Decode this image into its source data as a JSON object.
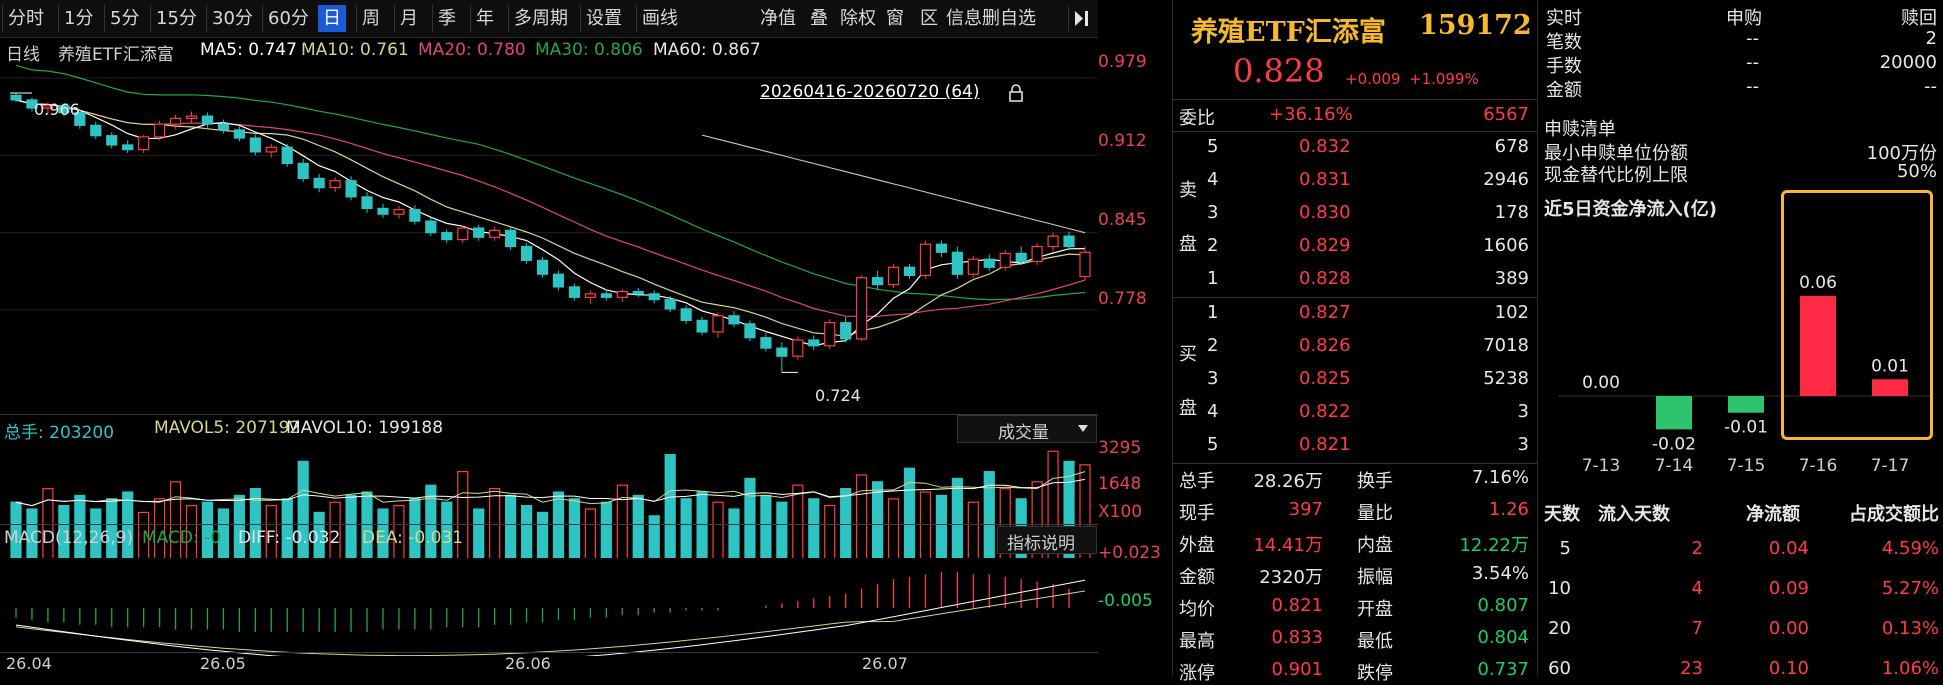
{
  "toolbar": {
    "periods": [
      "分时",
      "1分",
      "5分",
      "15分",
      "30分",
      "60分",
      "日",
      "周",
      "月",
      "季",
      "年",
      "多周期",
      "设置",
      "画线"
    ],
    "active": "日",
    "right_items": [
      "净值",
      "叠",
      "除权",
      "窗",
      "区",
      "信息",
      "删自选"
    ]
  },
  "chart_header": {
    "period": "日线",
    "name": "养殖ETF汇添富",
    "ma5": "MA5: 0.747",
    "ma10": "MA10: 0.761",
    "ma20": "MA20: 0.780",
    "ma30": "MA30: 0.806",
    "ma60": "MA60: 0.867",
    "range_label": "20260416-20260720 (64)",
    "high_mark": "0.966",
    "low_mark": "0.724"
  },
  "price_axis": [
    "0.979",
    "0.912",
    "0.845",
    "0.778"
  ],
  "volume_header": {
    "total": "总手: 203200",
    "mavol5": "MAVOL5: 207192",
    "mavol10": "MAVOL10: 199188",
    "dropdown": "成交量",
    "axis": [
      "3295",
      "1648",
      "X100"
    ]
  },
  "macd_header": {
    "title": "MACD(12,26,9)",
    "macd": "MACD: -0",
    "diff": "DIFF: -0.032",
    "dea": "DEA: -0.031",
    "explain_button": "指标说明",
    "axis": [
      "+0.023",
      "-0.005"
    ]
  },
  "date_axis": [
    "26.04",
    "26.05",
    "26.06",
    "26.07"
  ],
  "quote": {
    "name": "养殖ETF汇添富",
    "code": "159172",
    "price": "0.828",
    "change": "+0.009",
    "change_pct": "+1.099%",
    "weibi_label": "委比",
    "weibi_pct": "+36.16%",
    "weibi_diff": "6567",
    "sell_label": [
      "卖",
      "盘"
    ],
    "buy_label": [
      "买",
      "盘"
    ],
    "asks": [
      {
        "level": "5",
        "price": "0.832",
        "vol": "678"
      },
      {
        "level": "4",
        "price": "0.831",
        "vol": "2946"
      },
      {
        "level": "3",
        "price": "0.830",
        "vol": "178"
      },
      {
        "level": "2",
        "price": "0.829",
        "vol": "1606"
      },
      {
        "level": "1",
        "price": "0.828",
        "vol": "389"
      }
    ],
    "bids": [
      {
        "level": "1",
        "price": "0.827",
        "vol": "102"
      },
      {
        "level": "2",
        "price": "0.826",
        "vol": "7018"
      },
      {
        "level": "3",
        "price": "0.825",
        "vol": "5238"
      },
      {
        "level": "4",
        "price": "0.822",
        "vol": "3"
      },
      {
        "level": "5",
        "price": "0.821",
        "vol": "3"
      }
    ],
    "stats": [
      {
        "l1": "总手",
        "v1": "28.26万",
        "c1": "wht",
        "l2": "换手",
        "v2": "7.16%",
        "c2": "wht"
      },
      {
        "l1": "现手",
        "v1": "397",
        "c1": "red",
        "l2": "量比",
        "v2": "1.26",
        "c2": "red"
      },
      {
        "l1": "外盘",
        "v1": "14.41万",
        "c1": "red",
        "l2": "内盘",
        "v2": "12.22万",
        "c2": "grn"
      },
      {
        "l1": "金额",
        "v1": "2320万",
        "c1": "wht",
        "l2": "振幅",
        "v2": "3.54%",
        "c2": "wht"
      },
      {
        "l1": "均价",
        "v1": "0.821",
        "c1": "red",
        "l2": "开盘",
        "v2": "0.807",
        "c2": "grn"
      },
      {
        "l1": "最高",
        "v1": "0.833",
        "c1": "red",
        "l2": "最低",
        "v2": "0.804",
        "c2": "grn"
      },
      {
        "l1": "涨停",
        "v1": "0.901",
        "c1": "red",
        "l2": "跌停",
        "v2": "0.737",
        "c2": "grn"
      }
    ]
  },
  "subscription": {
    "headers": [
      "实时",
      "申购",
      "赎回"
    ],
    "rows": [
      {
        "label": "笔数",
        "sub": "--",
        "red": "2"
      },
      {
        "label": "手数",
        "sub": "--",
        "red": "20000"
      },
      {
        "label": "金额",
        "sub": "--",
        "red": "--"
      }
    ],
    "list_title": "申赎清单",
    "list_rows": [
      {
        "label": "最小申赎单位份额",
        "value": "100万份"
      },
      {
        "label": "现金替代比例上限",
        "value": "50%"
      }
    ]
  },
  "flow": {
    "title": "近5日资金净流入(亿)",
    "days": [
      "7-13",
      "7-14",
      "7-15",
      "7-16",
      "7-17"
    ],
    "value_labels": [
      "0.00",
      "-0.02",
      "-0.01",
      "0.06",
      "0.01"
    ],
    "table_headers": [
      "天数",
      "流入天数",
      "净流额",
      "占成交额比"
    ],
    "table_rows": [
      {
        "days": "5",
        "in_days": "2",
        "net": "0.04",
        "ratio": "4.59%"
      },
      {
        "days": "10",
        "in_days": "4",
        "net": "0.09",
        "ratio": "5.27%"
      },
      {
        "days": "20",
        "in_days": "7",
        "net": "0.00",
        "ratio": "0.13%"
      },
      {
        "days": "60",
        "in_days": "23",
        "net": "0.10",
        "ratio": "1.06%"
      }
    ]
  },
  "chart_data": [
    {
      "type": "candlestick",
      "title": "养殖ETF汇添富 日线",
      "ylim": [
        0.724,
        0.979
      ],
      "y_ticks": [
        0.979,
        0.912,
        0.845,
        0.778
      ],
      "x_ticks": [
        "26.04",
        "26.05",
        "26.06",
        "26.07"
      ],
      "high_label": 0.966,
      "low_label": 0.724,
      "ohlc": [
        [
          0.964,
          0.966,
          0.958,
          0.96
        ],
        [
          0.96,
          0.962,
          0.95,
          0.953
        ],
        [
          0.953,
          0.958,
          0.948,
          0.955
        ],
        [
          0.955,
          0.957,
          0.946,
          0.949
        ],
        [
          0.949,
          0.952,
          0.935,
          0.938
        ],
        [
          0.938,
          0.941,
          0.926,
          0.929
        ],
        [
          0.929,
          0.932,
          0.918,
          0.921
        ],
        [
          0.921,
          0.925,
          0.914,
          0.917
        ],
        [
          0.917,
          0.93,
          0.914,
          0.928
        ],
        [
          0.928,
          0.942,
          0.925,
          0.939
        ],
        [
          0.939,
          0.947,
          0.935,
          0.944
        ],
        [
          0.944,
          0.95,
          0.94,
          0.946
        ],
        [
          0.946,
          0.949,
          0.936,
          0.939
        ],
        [
          0.939,
          0.943,
          0.931,
          0.934
        ],
        [
          0.934,
          0.937,
          0.924,
          0.927
        ],
        [
          0.927,
          0.93,
          0.912,
          0.915
        ],
        [
          0.915,
          0.922,
          0.91,
          0.919
        ],
        [
          0.919,
          0.922,
          0.902,
          0.905
        ],
        [
          0.905,
          0.909,
          0.889,
          0.892
        ],
        [
          0.892,
          0.896,
          0.88,
          0.884
        ],
        [
          0.884,
          0.893,
          0.88,
          0.89
        ],
        [
          0.89,
          0.894,
          0.873,
          0.876
        ],
        [
          0.876,
          0.88,
          0.862,
          0.866
        ],
        [
          0.866,
          0.87,
          0.858,
          0.861
        ],
        [
          0.861,
          0.868,
          0.857,
          0.865
        ],
        [
          0.865,
          0.869,
          0.852,
          0.855
        ],
        [
          0.855,
          0.858,
          0.842,
          0.845
        ],
        [
          0.845,
          0.848,
          0.836,
          0.839
        ],
        [
          0.839,
          0.851,
          0.836,
          0.849
        ],
        [
          0.849,
          0.852,
          0.838,
          0.841
        ],
        [
          0.841,
          0.85,
          0.838,
          0.847
        ],
        [
          0.847,
          0.85,
          0.83,
          0.833
        ],
        [
          0.833,
          0.836,
          0.818,
          0.821
        ],
        [
          0.821,
          0.824,
          0.806,
          0.809
        ],
        [
          0.809,
          0.812,
          0.795,
          0.798
        ],
        [
          0.798,
          0.801,
          0.786,
          0.789
        ],
        [
          0.789,
          0.795,
          0.783,
          0.792
        ],
        [
          0.792,
          0.796,
          0.786,
          0.789
        ],
        [
          0.789,
          0.796,
          0.785,
          0.794
        ],
        [
          0.794,
          0.797,
          0.789,
          0.792
        ],
        [
          0.792,
          0.795,
          0.784,
          0.787
        ],
        [
          0.787,
          0.79,
          0.776,
          0.779
        ],
        [
          0.779,
          0.782,
          0.766,
          0.769
        ],
        [
          0.769,
          0.772,
          0.756,
          0.759
        ],
        [
          0.759,
          0.776,
          0.754,
          0.773
        ],
        [
          0.773,
          0.777,
          0.763,
          0.766
        ],
        [
          0.766,
          0.769,
          0.751,
          0.754
        ],
        [
          0.754,
          0.758,
          0.742,
          0.745
        ],
        [
          0.745,
          0.75,
          0.724,
          0.738
        ],
        [
          0.738,
          0.755,
          0.735,
          0.752
        ],
        [
          0.752,
          0.756,
          0.743,
          0.747
        ],
        [
          0.747,
          0.77,
          0.744,
          0.767
        ],
        [
          0.767,
          0.772,
          0.75,
          0.753
        ],
        [
          0.753,
          0.808,
          0.751,
          0.806
        ],
        [
          0.806,
          0.812,
          0.796,
          0.8
        ],
        [
          0.8,
          0.818,
          0.797,
          0.815
        ],
        [
          0.815,
          0.818,
          0.805,
          0.808
        ],
        [
          0.808,
          0.838,
          0.805,
          0.835
        ],
        [
          0.835,
          0.838,
          0.824,
          0.828
        ],
        [
          0.828,
          0.833,
          0.805,
          0.809
        ],
        [
          0.809,
          0.825,
          0.806,
          0.822
        ],
        [
          0.822,
          0.826,
          0.812,
          0.815
        ],
        [
          0.815,
          0.83,
          0.812,
          0.827
        ],
        [
          0.827,
          0.833,
          0.817,
          0.82
        ],
        [
          0.82,
          0.836,
          0.817,
          0.833
        ],
        [
          0.833,
          0.845,
          0.829,
          0.842
        ],
        [
          0.842,
          0.846,
          0.83,
          0.833
        ],
        [
          0.807,
          0.833,
          0.804,
          0.828
        ]
      ]
    },
    {
      "type": "bar",
      "title": "成交量",
      "ylim": [
        0,
        3295
      ],
      "values": [
        1700,
        1500,
        2100,
        1600,
        1900,
        1500,
        1800,
        2000,
        1400,
        1800,
        2300,
        1600,
        1700,
        1500,
        1900,
        2100,
        1600,
        1800,
        2900,
        1400,
        1700,
        1900,
        2000,
        1500,
        1600,
        1800,
        2200,
        1700,
        2600,
        1500,
        2100,
        1900,
        1600,
        1400,
        2000,
        1800,
        1500,
        1700,
        2200,
        1900,
        1300,
        3100,
        1800,
        2000,
        1700,
        1500,
        2400,
        1900,
        1700,
        2200,
        1800,
        1600,
        2100,
        2500,
        2300,
        1800,
        2700,
        2000,
        1900,
        2400,
        1700,
        2600,
        2100,
        1800,
        2300,
        3200,
        2900,
        2800
      ]
    },
    {
      "type": "bar",
      "title": "MACD(12,26,9)",
      "ylim": [
        -0.04,
        0.03
      ],
      "values": [
        -0.004,
        -0.005,
        -0.006,
        -0.006,
        -0.007,
        -0.007,
        -0.008,
        -0.008,
        -0.008,
        -0.008,
        -0.009,
        -0.009,
        -0.009,
        -0.009,
        -0.01,
        -0.01,
        -0.01,
        -0.01,
        -0.01,
        -0.01,
        -0.01,
        -0.01,
        -0.01,
        -0.009,
        -0.009,
        -0.009,
        -0.009,
        -0.008,
        -0.008,
        -0.008,
        -0.007,
        -0.007,
        -0.006,
        -0.006,
        -0.005,
        -0.005,
        -0.004,
        -0.004,
        -0.003,
        -0.003,
        -0.002,
        -0.002,
        -0.001,
        -0.001,
        -0.001,
        0.0,
        0.0,
        0.001,
        0.002,
        0.003,
        0.004,
        0.005,
        0.006,
        0.008,
        0.01,
        0.012,
        0.013,
        0.014,
        0.015,
        0.015,
        0.014,
        0.014,
        0.013,
        0.012,
        0.011,
        0.01,
        0.008,
        -0.0
      ]
    },
    {
      "type": "bar",
      "title": "近5日资金净流入(亿)",
      "categories": [
        "7-13",
        "7-14",
        "7-15",
        "7-16",
        "7-17"
      ],
      "values": [
        0.0,
        -0.02,
        -0.01,
        0.06,
        0.01
      ]
    }
  ],
  "colors": {
    "up": "#ff3b48",
    "down": "#2ec4c4",
    "ma5": "#ffffff",
    "ma10": "#d6d68a",
    "ma20": "#e0457a",
    "ma30": "#1fa84a",
    "ma60": "#c8c8c8",
    "highlight": "#f5b82e",
    "active_tab": "#1b5cd6"
  }
}
